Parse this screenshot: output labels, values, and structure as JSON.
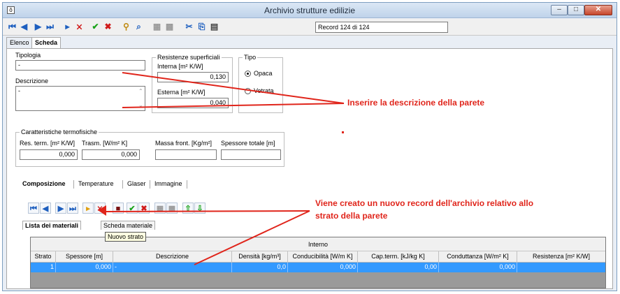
{
  "window": {
    "title": "Archivio strutture edilizie",
    "app_icon": "ô"
  },
  "toolbar": {
    "record_text": "Record 124 di 124",
    "buttons": [
      "first-icon",
      "prev-icon",
      "next-icon",
      "last-icon",
      "insert-icon",
      "delete-icon",
      "confirm-icon",
      "cancel-icon",
      "filter-icon",
      "find-icon",
      "grid-icon",
      "grid2-icon",
      "cut-icon",
      "copy-icon",
      "paste-icon"
    ]
  },
  "outer_tabs": [
    "Elenco",
    "Scheda"
  ],
  "form": {
    "tipologia_label": "Tipologia",
    "tipologia_value": "-",
    "descrizione_label": "Descrizione",
    "descrizione_value": "-",
    "resistenze_title": "Resistenze superficiali",
    "interna_label": "Interna [m² K/W]",
    "interna_value": "0,130",
    "esterna_label": "Esterna [m² K/W]",
    "esterna_value": "0,040",
    "tipo_title": "Tipo",
    "tipo_options": [
      "Opaca",
      "Vetrata"
    ],
    "tipo_selected": "Opaca",
    "caratteristiche_title": "Caratteristiche termofisiche",
    "res_term_label": "Res. term. [m² K/W]",
    "res_term_value": "0,000",
    "trasm_label": "Trasm. [W/m² K]",
    "trasm_value": "0,000",
    "massa_label": "Massa front. [Kg/m²]",
    "massa_value": "",
    "spessore_label": "Spessore totale [m]",
    "spessore_value": ""
  },
  "inner_tabs": [
    "Composizione",
    "Temperature",
    "Glaser",
    "Immagine"
  ],
  "sub_tabs": [
    "Lista dei materiali",
    "Scheda materiale"
  ],
  "tooltip": "Nuovo strato",
  "grid": {
    "group_header": "Interno",
    "columns": [
      "Strato",
      "Spessore [m]",
      "Descrizione",
      "Densità [kg/m³]",
      "Conducibilità [W/m K]",
      "Cap.term. [kJ/kg K]",
      "Conduttanza [W/m² K]",
      "Resistenza [m² K/W]"
    ],
    "rows": [
      [
        "1",
        "0,000",
        "-",
        "0,0",
        "0,000",
        "0,00",
        "0,000",
        ""
      ]
    ]
  },
  "annotations": {
    "text1": "Inserire la descrizione della parete",
    "text2_line1": "Viene creato un nuovo record dell'archivio relativo allo",
    "text2_line2": "strato della parete",
    "color": "#e0251b"
  }
}
